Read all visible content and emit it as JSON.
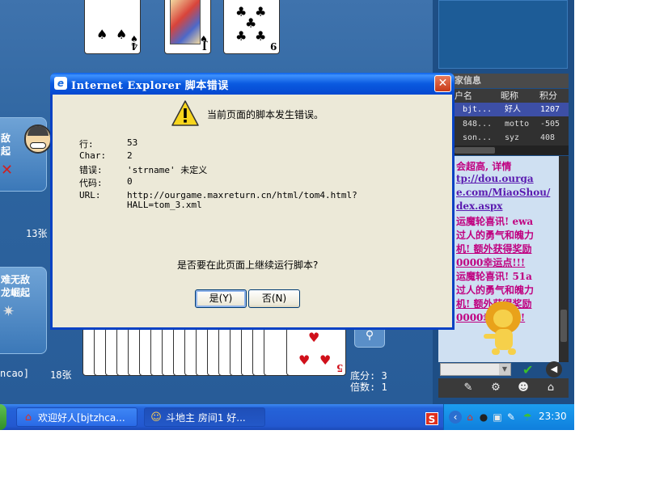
{
  "game": {
    "left_count_top": "13张",
    "left_count_bottom": "18张",
    "left_name_bottom": "ncao]",
    "left_label_top": [
      "敌",
      "起"
    ],
    "left_label_bottom": [
      "难无敌",
      "龙崛起"
    ],
    "score_label": "底分: 3",
    "multiplier_label": "倍数: 1",
    "top_cards": [
      {
        "rank": "4",
        "suit": "♠",
        "color": "black"
      },
      {
        "rank": "J",
        "suit": "♠",
        "color": "black"
      },
      {
        "rank": "9",
        "suit": "♣",
        "color": "black"
      }
    ],
    "hand_last_card": {
      "rank": "5",
      "suit": "♥",
      "color": "red"
    },
    "hand_partial_rank": "R"
  },
  "sidebar": {
    "info_title": "家信息",
    "columns": [
      "户名",
      "昵称",
      "积分"
    ],
    "rows": [
      {
        "account": "bjt...",
        "nickname": "好人",
        "score": "1207",
        "selected": true
      },
      {
        "account": "848...",
        "nickname": "motto",
        "score": "-505",
        "selected": false
      },
      {
        "account": "son...",
        "nickname": "syz",
        "score": "408",
        "selected": false
      }
    ],
    "chat_lines": [
      {
        "text": "会超高, 详情",
        "color": "#c00080",
        "underline": false
      },
      {
        "text": "tp://dou.ourga",
        "color": "#5a1ab0",
        "underline": true
      },
      {
        "text": "e.com/MiaoShou/",
        "color": "#5a1ab0",
        "underline": true
      },
      {
        "text": "dex.aspx",
        "color": "#5a1ab0",
        "underline": true
      },
      {
        "text": "运魔轮喜讯! ewa",
        "color": "#c00080",
        "underline": false
      },
      {
        "text": "过人的勇气和魄力",
        "color": "#c00080",
        "underline": false
      },
      {
        "text": "机! 额外获得奖励",
        "color": "#c00080",
        "underline": true
      },
      {
        "text": "0000幸运点!!!",
        "color": "#c00080",
        "underline": true
      },
      {
        "text": "运魔轮喜讯! 51a",
        "color": "#c00080",
        "underline": false
      },
      {
        "text": "过人的勇气和魄力",
        "color": "#c00080",
        "underline": false
      },
      {
        "text": "机! 额外获得奖励",
        "color": "#c00080",
        "underline": true
      },
      {
        "text": "0000幸运点!!!",
        "color": "#c00080",
        "underline": true
      }
    ]
  },
  "dialog": {
    "title": "Internet Explorer 脚本错误",
    "close_label": "✕",
    "message": "当前页面的脚本发生错误。",
    "fields": [
      {
        "label": "行:",
        "value": "53"
      },
      {
        "label": "Char:",
        "value": "2"
      },
      {
        "label": "错误:",
        "value": "'strname' 未定义"
      },
      {
        "label": "代码:",
        "value": "0"
      },
      {
        "label": "URL:",
        "value": "http://ourgame.maxreturn.cn/html/tom4.html?"
      }
    ],
    "url_continued": "HALL=tom_3.xml",
    "question": "是否要在此页面上继续运行脚本?",
    "yes_label": "是(Y)",
    "no_label": "否(N)"
  },
  "taskbar": {
    "tasks": [
      {
        "label": "欢迎好人[bjtzhca...",
        "active": false
      },
      {
        "label": "斗地主 房间1 好...",
        "active": true
      }
    ],
    "clock": "23:30",
    "tray_s": "S"
  },
  "colors": {
    "titlebar_blue": "#0a5ae0",
    "close_red": "#c83a18",
    "table_blue": "#2d649f",
    "tray_blue": "#0f7fdc"
  }
}
